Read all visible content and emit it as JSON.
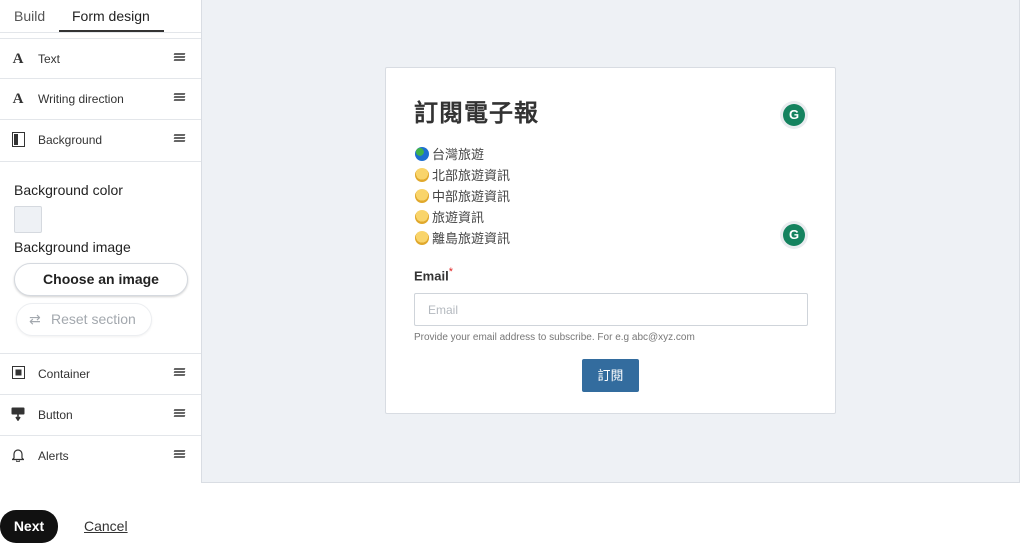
{
  "tabs": [
    {
      "label": "Build",
      "active": false
    },
    {
      "label": "Form design",
      "active": true
    }
  ],
  "settings_top": [
    {
      "label": "Text",
      "icon": "text-format-icon"
    },
    {
      "label": "Writing direction",
      "icon": "text-format-icon"
    },
    {
      "label": "Background",
      "icon": "background-icon"
    }
  ],
  "background_panel": {
    "color_heading": "Background color",
    "color_value": "#eef1f5",
    "image_heading": "Background image",
    "choose_label": "Choose an image",
    "reset_label": "Reset section"
  },
  "settings_bottom": [
    {
      "label": "Container",
      "icon": "container-icon"
    },
    {
      "label": "Button",
      "icon": "button-icon"
    },
    {
      "label": "Alerts",
      "icon": "bell-icon"
    }
  ],
  "form": {
    "title": "訂閱電子報",
    "lines": [
      {
        "emoji": "globe-icon",
        "text": "台灣旅遊"
      },
      {
        "emoji": "chick-icon",
        "text": "北部旅遊資訊"
      },
      {
        "emoji": "chick-icon",
        "text": "中部旅遊資訊"
      },
      {
        "emoji": "chick-icon",
        "text": "旅遊資訊"
      },
      {
        "emoji": "chick-icon",
        "text": "離島旅遊資訊"
      }
    ],
    "email_label": "Email",
    "required_mark": "*",
    "email_placeholder": "Email",
    "email_value": "",
    "hint": "Provide your email address to subscribe. For e.g abc@xyz.com",
    "submit_label": "訂閱",
    "grammarly_badge": "G"
  },
  "footer": {
    "next_label": "Next",
    "cancel_label": "Cancel"
  },
  "colors": {
    "canvas_bg": "#eef1f5",
    "submit_bg": "#336c9e",
    "next_bg": "#111111",
    "grammarly": "#15835f"
  }
}
